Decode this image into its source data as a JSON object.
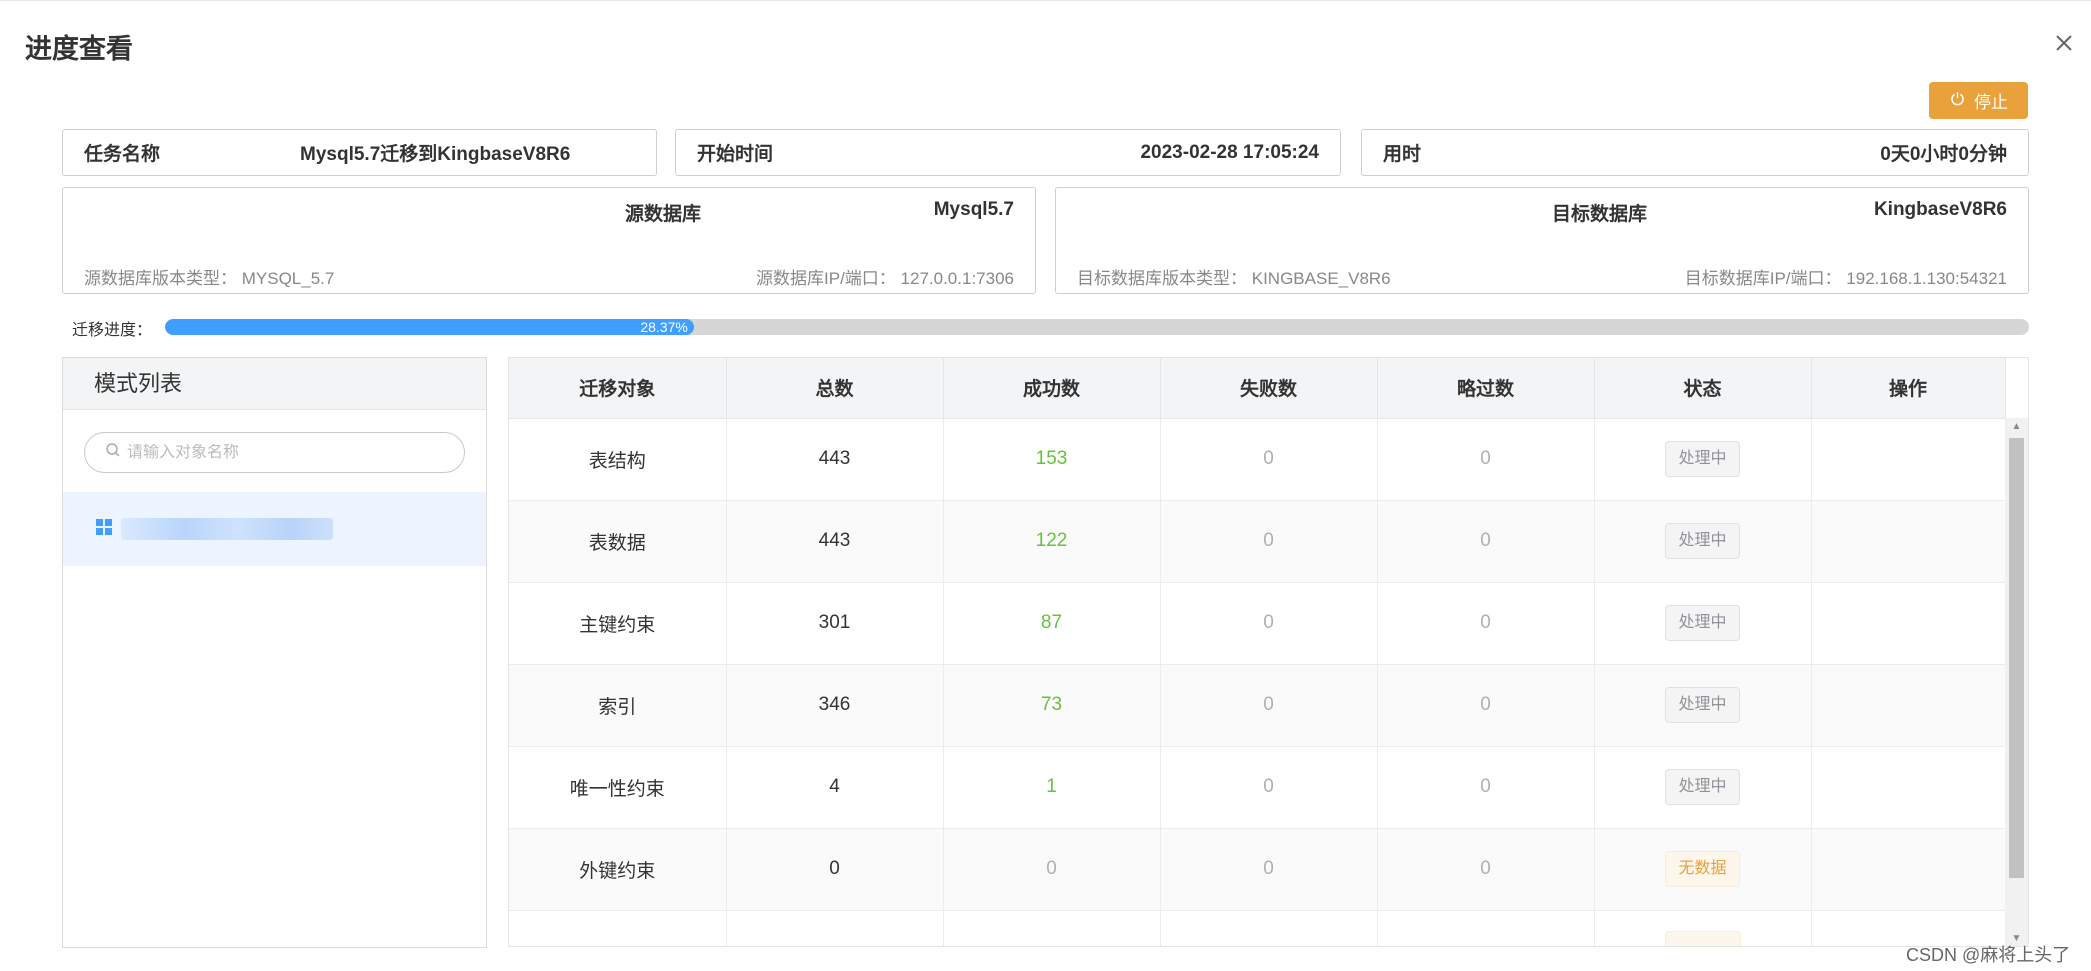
{
  "dialog": {
    "title": "进度查看"
  },
  "actions": {
    "stop_label": "停止"
  },
  "task": {
    "name_label": "任务名称",
    "name_value": "Mysql5.7迁移到KingbaseV8R6",
    "start_label": "开始时间",
    "start_value": "2023-02-28 17:05:24",
    "used_label": "用时",
    "used_value": "0天0小时0分钟"
  },
  "source_db": {
    "title": "源数据库",
    "name": "Mysql5.7",
    "version_label": "源数据库版本类型：",
    "version_value": "MYSQL_5.7",
    "ip_label": "源数据库IP/端口：",
    "ip_value": "127.0.0.1:7306"
  },
  "target_db": {
    "title": "目标数据库",
    "name": "KingbaseV8R6",
    "version_label": "目标数据库版本类型：",
    "version_value": "KINGBASE_V8R6",
    "ip_label": "目标数据库IP/端口：",
    "ip_value": "192.168.1.130:54321"
  },
  "progress": {
    "label": "迁移进度：",
    "percent": 28.37,
    "text": "28.37%"
  },
  "schema_panel": {
    "title": "模式列表",
    "search_placeholder": "请输入对象名称"
  },
  "table": {
    "headers": [
      "迁移对象",
      "总数",
      "成功数",
      "失败数",
      "略过数",
      "状态",
      "操作"
    ],
    "rows": [
      {
        "object": "表结构",
        "total": "443",
        "success": "153",
        "failed": "0",
        "skipped": "0",
        "status": "处理中"
      },
      {
        "object": "表数据",
        "total": "443",
        "success": "122",
        "failed": "0",
        "skipped": "0",
        "status": "处理中"
      },
      {
        "object": "主键约束",
        "total": "301",
        "success": "87",
        "failed": "0",
        "skipped": "0",
        "status": "处理中"
      },
      {
        "object": "索引",
        "total": "346",
        "success": "73",
        "failed": "0",
        "skipped": "0",
        "status": "处理中"
      },
      {
        "object": "唯一性约束",
        "total": "4",
        "success": "1",
        "failed": "0",
        "skipped": "0",
        "status": "处理中"
      },
      {
        "object": "外键约束",
        "total": "0",
        "success": "0",
        "failed": "0",
        "skipped": "0",
        "status": "无数据"
      }
    ]
  },
  "watermark": "CSDN @麻将上头了",
  "colors": {
    "accent_blue": "#409eff",
    "stop_orange": "#e9a23b",
    "success_green": "#67c23a",
    "nodata_orange": "#e6a23c"
  }
}
